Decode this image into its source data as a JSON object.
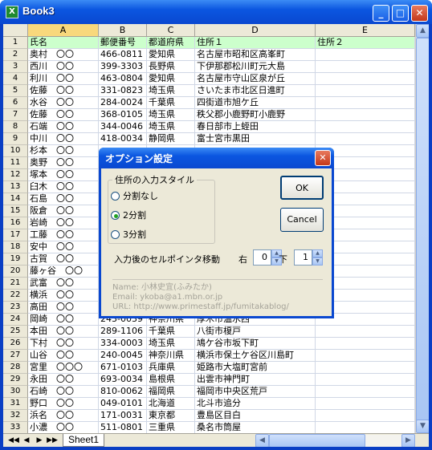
{
  "window": {
    "title": "Book3",
    "app_icon": "excel-icon",
    "minimize": "_",
    "maximize": "□",
    "close": "✕"
  },
  "columns": [
    "A",
    "B",
    "C",
    "D",
    "E"
  ],
  "selected_column": "A",
  "rows": [
    {
      "num": "1",
      "a": "氏名",
      "b": "郵便番号",
      "c": "都道府県",
      "d": "住所１",
      "e": "住所２"
    },
    {
      "num": "2",
      "a": "奥村　〇〇",
      "b": "466-0811",
      "c": "愛知県",
      "d": "名古屋市昭和区高峯町",
      "e": ""
    },
    {
      "num": "3",
      "a": "西川　〇〇",
      "b": "399-3303",
      "c": "長野県",
      "d": "下伊那郡松川町元大島",
      "e": ""
    },
    {
      "num": "4",
      "a": "利川　〇〇",
      "b": "463-0804",
      "c": "愛知県",
      "d": "名古屋市守山区泉が丘",
      "e": ""
    },
    {
      "num": "5",
      "a": "佐藤　〇〇",
      "b": "331-0823",
      "c": "埼玉県",
      "d": "さいたま市北区日進町",
      "e": ""
    },
    {
      "num": "6",
      "a": "水谷　〇〇",
      "b": "284-0024",
      "c": "千葉県",
      "d": "四街道市旭ケ丘",
      "e": ""
    },
    {
      "num": "7",
      "a": "佐藤　〇〇",
      "b": "368-0105",
      "c": "埼玉県",
      "d": "秩父郡小鹿野町小鹿野",
      "e": ""
    },
    {
      "num": "8",
      "a": "石端　〇〇",
      "b": "344-0046",
      "c": "埼玉県",
      "d": "春日部市上蛭田",
      "e": ""
    },
    {
      "num": "9",
      "a": "中川　〇〇",
      "b": "418-0034",
      "c": "静岡県",
      "d": "富士宮市黒田",
      "e": ""
    },
    {
      "num": "10",
      "a": "杉本　〇〇",
      "b": "",
      "c": "",
      "d": "",
      "e": ""
    },
    {
      "num": "11",
      "a": "奥野　〇〇",
      "b": "",
      "c": "",
      "d": "",
      "e": ""
    },
    {
      "num": "12",
      "a": "塚本　〇〇",
      "b": "",
      "c": "",
      "d": "",
      "e": ""
    },
    {
      "num": "13",
      "a": "臼木　〇〇",
      "b": "",
      "c": "",
      "d": "",
      "e": ""
    },
    {
      "num": "14",
      "a": "石島　〇〇",
      "b": "",
      "c": "",
      "d": "",
      "e": ""
    },
    {
      "num": "15",
      "a": "阪倉　〇〇",
      "b": "",
      "c": "",
      "d": "",
      "e": ""
    },
    {
      "num": "16",
      "a": "岩崎　〇〇",
      "b": "",
      "c": "",
      "d": "",
      "e": ""
    },
    {
      "num": "17",
      "a": "工藤　〇〇",
      "b": "",
      "c": "",
      "d": "",
      "e": ""
    },
    {
      "num": "18",
      "a": "安中　〇〇",
      "b": "",
      "c": "",
      "d": "",
      "e": ""
    },
    {
      "num": "19",
      "a": "古賀　〇〇",
      "b": "",
      "c": "",
      "d": "",
      "e": ""
    },
    {
      "num": "20",
      "a": "藤ヶ谷　〇〇",
      "b": "",
      "c": "",
      "d": "",
      "e": ""
    },
    {
      "num": "21",
      "a": "武富　〇〇",
      "b": "",
      "c": "",
      "d": "",
      "e": ""
    },
    {
      "num": "22",
      "a": "横浜　〇〇",
      "b": "",
      "c": "",
      "d": "",
      "e": ""
    },
    {
      "num": "23",
      "a": "高田　〇〇",
      "b": "",
      "c": "",
      "d": "",
      "e": ""
    },
    {
      "num": "24",
      "a": "岡崎　〇〇",
      "b": "243-0039",
      "c": "神奈川県",
      "d": "厚木市温水西",
      "e": ""
    },
    {
      "num": "25",
      "a": "本田　〇〇",
      "b": "289-1106",
      "c": "千葉県",
      "d": "八街市榎戸",
      "e": ""
    },
    {
      "num": "26",
      "a": "下村　〇〇",
      "b": "334-0003",
      "c": "埼玉県",
      "d": "鳩ケ谷市坂下町",
      "e": ""
    },
    {
      "num": "27",
      "a": "山谷　〇〇",
      "b": "240-0045",
      "c": "神奈川県",
      "d": "横浜市保土ケ谷区川島町",
      "e": ""
    },
    {
      "num": "28",
      "a": "宮里　〇〇〇",
      "b": "671-0103",
      "c": "兵庫県",
      "d": "姫路市大塩町宮前",
      "e": ""
    },
    {
      "num": "29",
      "a": "永田　〇〇",
      "b": "693-0034",
      "c": "島根県",
      "d": "出雲市神門町",
      "e": ""
    },
    {
      "num": "30",
      "a": "石崎　〇〇",
      "b": "810-0062",
      "c": "福岡県",
      "d": "福岡市中央区荒戸",
      "e": ""
    },
    {
      "num": "31",
      "a": "野口　〇〇",
      "b": "049-0101",
      "c": "北海道",
      "d": "北斗市追分",
      "e": ""
    },
    {
      "num": "32",
      "a": "浜名　〇〇",
      "b": "171-0031",
      "c": "東京都",
      "d": "豊島区目白",
      "e": ""
    },
    {
      "num": "33",
      "a": "小濃　〇〇",
      "b": "511-0801",
      "c": "三重県",
      "d": "桑名市筒屋",
      "e": ""
    }
  ],
  "sheet_tab": "Sheet1",
  "dialog": {
    "title": "オプション設定",
    "close": "✕",
    "group_label": "住所の入力スタイル",
    "radios": [
      {
        "label": "分割なし",
        "checked": false
      },
      {
        "label": "2分割",
        "checked": true
      },
      {
        "label": "3分割",
        "checked": false
      }
    ],
    "ok_label": "OK",
    "cancel_label": "Cancel",
    "move_label": "入力後のセルポインタ移動",
    "right_label": "右",
    "right_value": "0",
    "down_label": "下",
    "down_value": "1",
    "info_name": "Name: 小林史宜(ふみたか)",
    "info_email": "Email: ykoba@a1.mbn.or.jp",
    "info_url": "URL: http://www.primestaff.jp/fumitakablog/"
  }
}
